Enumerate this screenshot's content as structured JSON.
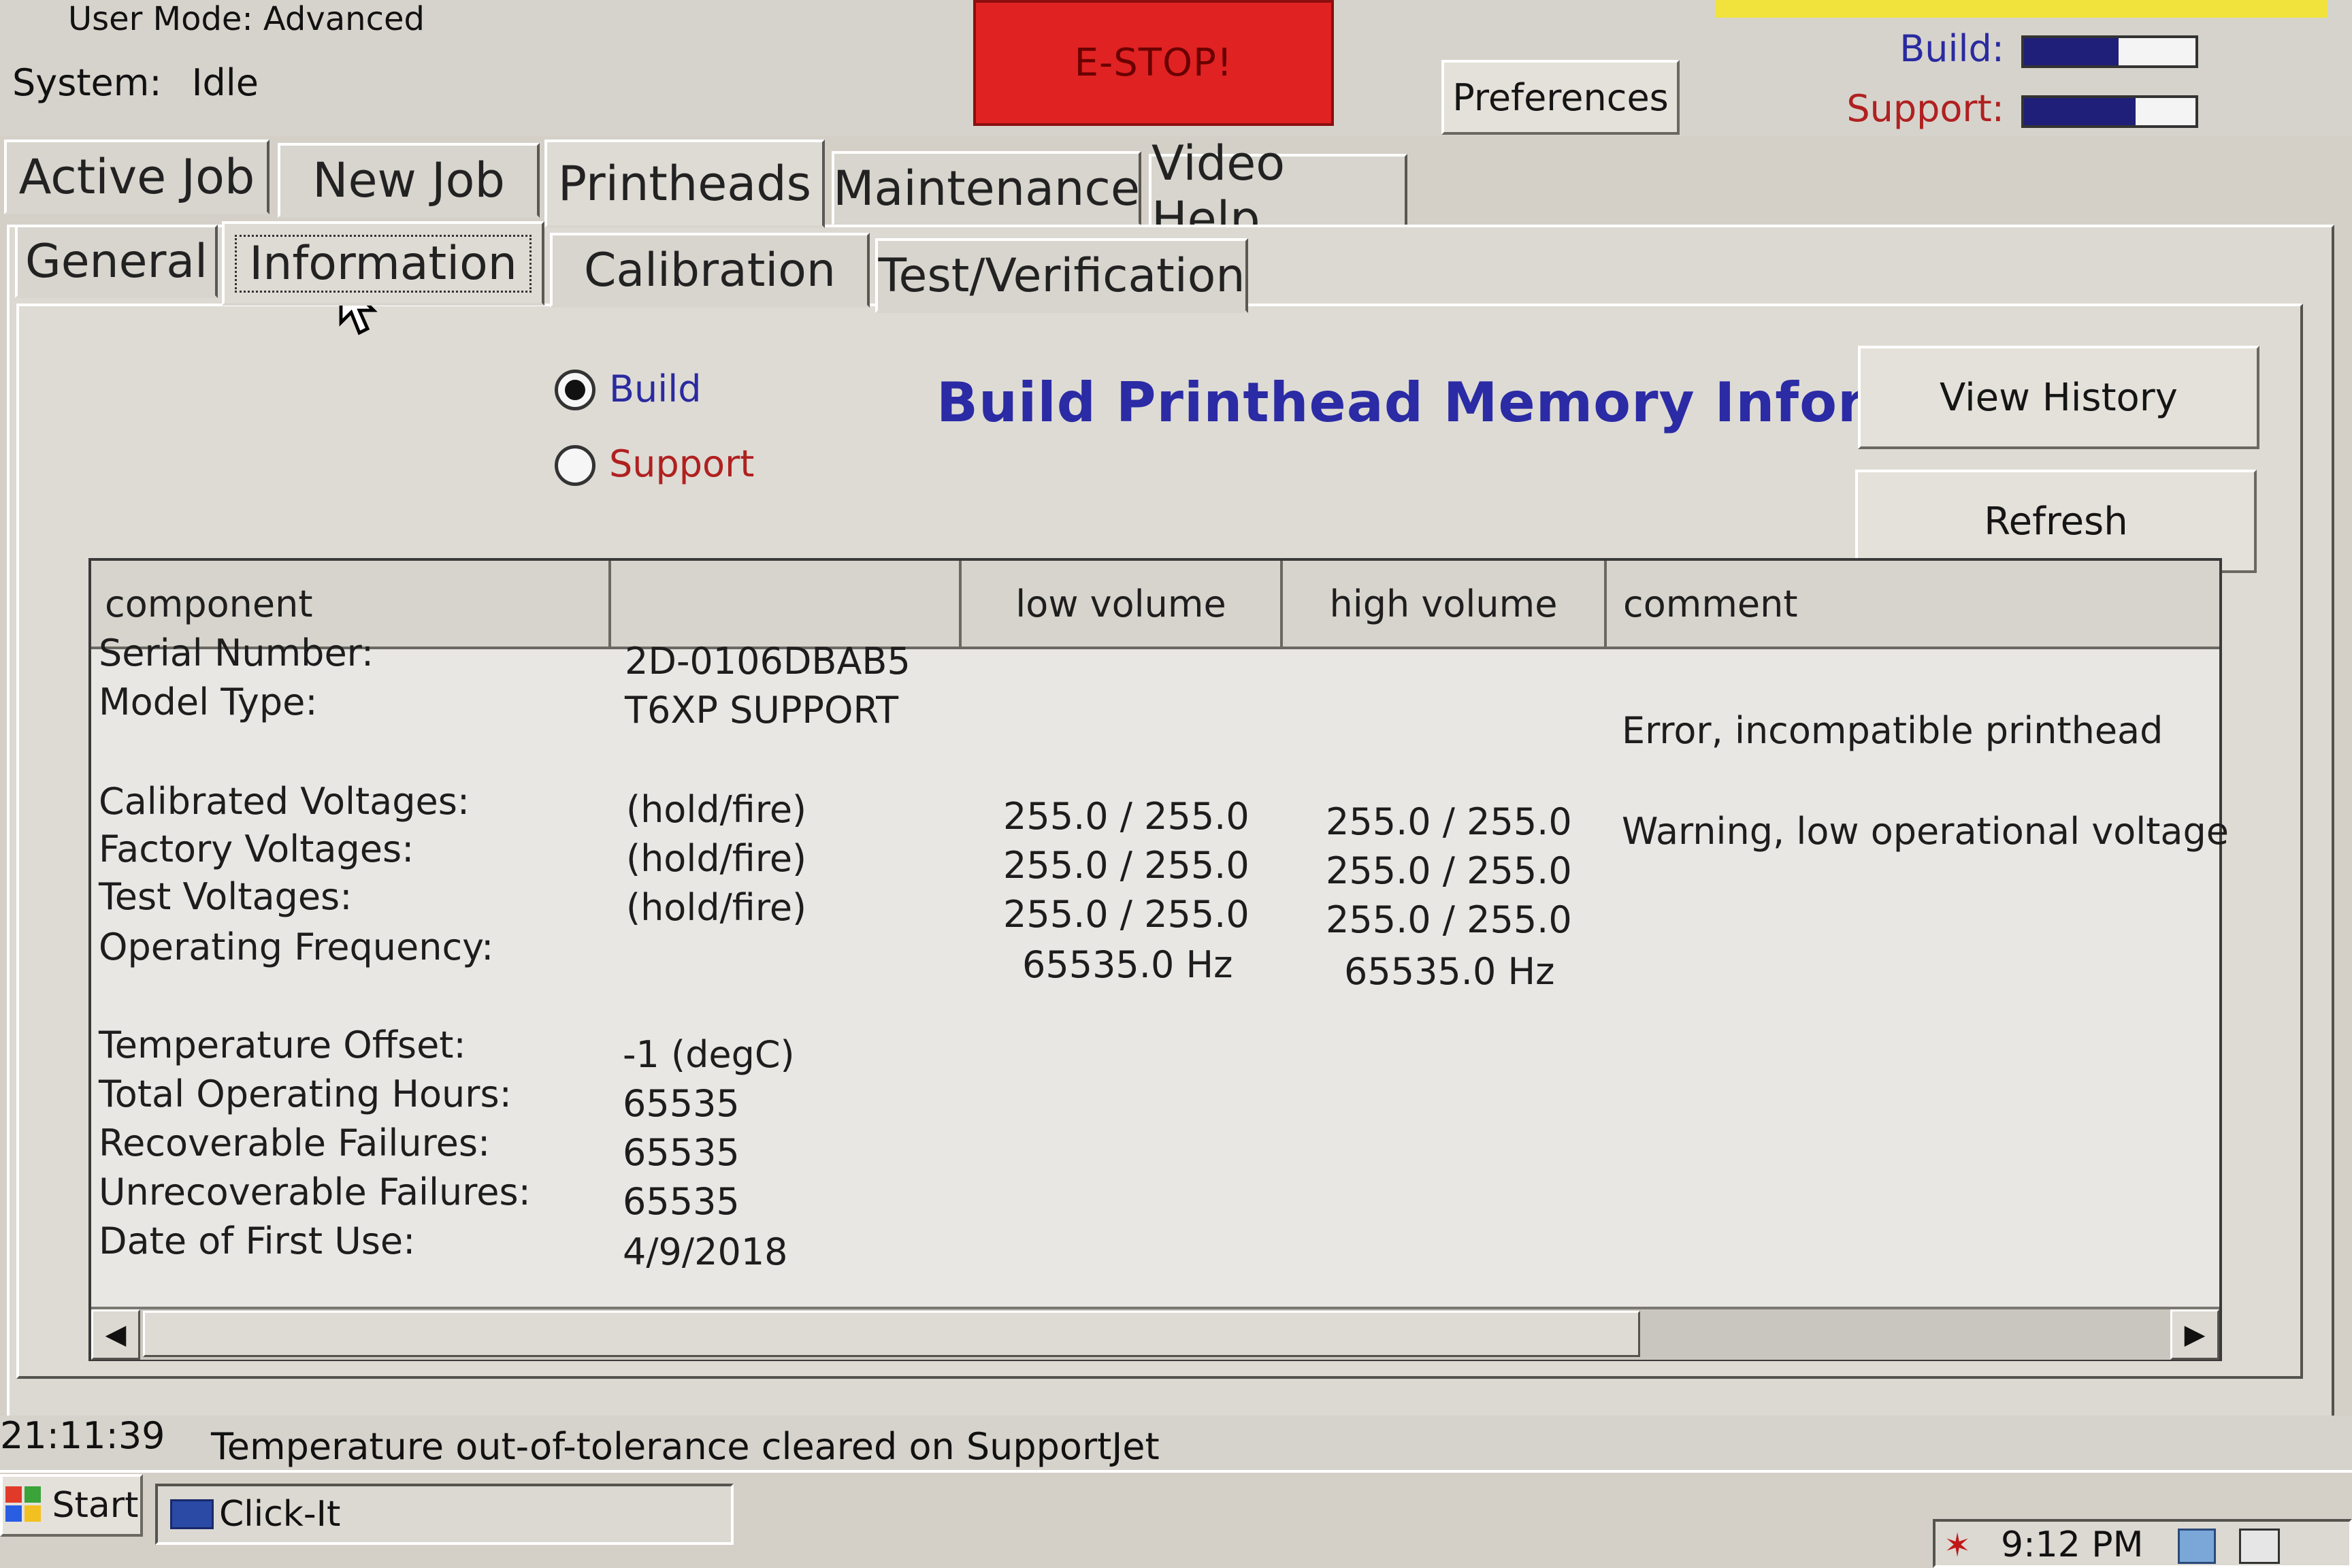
{
  "status": {
    "user_mode": "User Mode: Advanced",
    "system_label": "System:",
    "system_value": "Idle"
  },
  "estop_label": "E-STOP!",
  "preferences_label": "Preferences",
  "gauges": {
    "build_label": "Build:",
    "build_level_percent": 55,
    "support_label": "Support:",
    "support_level_percent": 65
  },
  "main_tabs": [
    "Active Job",
    "New Job",
    "Printheads",
    "Maintenance",
    "Video Help"
  ],
  "sub_tabs": [
    "General",
    "Information",
    "Calibration",
    "Test/Verification"
  ],
  "radio": {
    "build_label": "Build",
    "support_label": "Support",
    "selected": "Build"
  },
  "heading": "Build Printhead Memory Information",
  "buttons": {
    "view_history": "View History",
    "refresh": "Refresh"
  },
  "table": {
    "headers": [
      "component",
      "",
      "low volume",
      "high volume",
      "comment"
    ],
    "rows": [
      {
        "component": "Serial Number:",
        "value": "2D-0106DBAB5",
        "low": "",
        "high": "",
        "comment": ""
      },
      {
        "component": "Model Type:",
        "value": "T6XP SUPPORT",
        "low": "",
        "high": "",
        "comment": "Error, incompatible printhead"
      },
      {
        "component": "Calibrated Voltages:",
        "value": "(hold/fire)",
        "low": "255.0 / 255.0",
        "high": "255.0 / 255.0",
        "comment": "Warning, low operational voltage"
      },
      {
        "component": "Factory Voltages:",
        "value": "(hold/fire)",
        "low": "255.0 / 255.0",
        "high": "255.0 / 255.0",
        "comment": ""
      },
      {
        "component": "Test Voltages:",
        "value": "(hold/fire)",
        "low": "255.0 / 255.0",
        "high": "255.0 / 255.0",
        "comment": ""
      },
      {
        "component": "Operating Frequency:",
        "value": "",
        "low": "65535.0 Hz",
        "high": "65535.0 Hz",
        "comment": ""
      },
      {
        "component": "Temperature Offset:",
        "value": "-1 (degC)",
        "low": "",
        "high": "",
        "comment": ""
      },
      {
        "component": "Total Operating Hours:",
        "value": "65535",
        "low": "",
        "high": "",
        "comment": ""
      },
      {
        "component": "Recoverable Failures:",
        "value": "65535",
        "low": "",
        "high": "",
        "comment": ""
      },
      {
        "component": "Unrecoverable Failures:",
        "value": "65535",
        "low": "",
        "high": "",
        "comment": ""
      },
      {
        "component": "Date of First Use:",
        "value": "4/9/2018",
        "low": "",
        "high": "",
        "comment": ""
      }
    ]
  },
  "status_bar": {
    "time": "21:11:39",
    "message": "Temperature out-of-tolerance cleared on SupportJet"
  },
  "taskbar": {
    "start_label": "Start",
    "task_item_label": "Click-It",
    "clock": "9:12 PM"
  },
  "icons": {
    "start": "windows-flag-icon",
    "task_item": "app-icon",
    "cursor": "mouse-pointer-icon",
    "scroll_left": "arrow-left-icon",
    "scroll_right": "arrow-right-icon"
  },
  "colors": {
    "estop": "#e02222",
    "heading": "#2b2ba5",
    "build_label": "#2a2aa0",
    "support_label": "#b02020",
    "gauge_fill": "#1f1f7a"
  }
}
